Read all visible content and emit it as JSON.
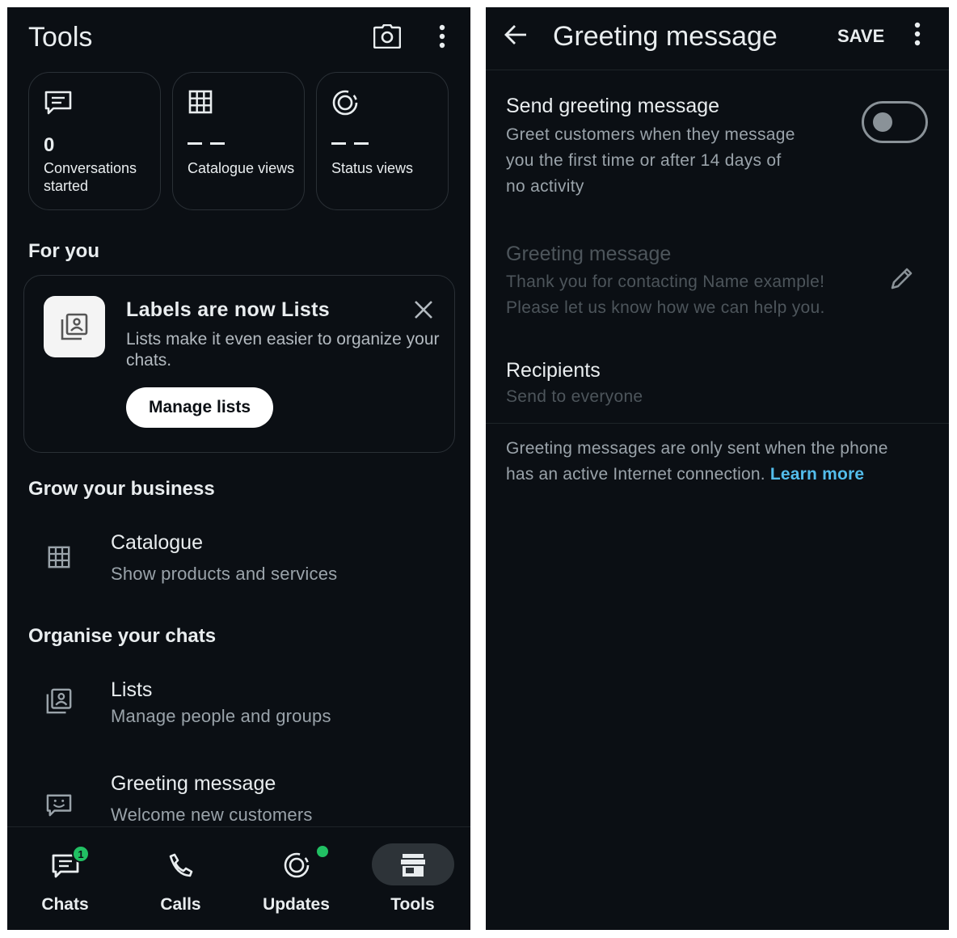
{
  "left": {
    "title": "Tools",
    "stats": [
      {
        "value": "0",
        "label": "Conversations started"
      },
      {
        "value": "– –",
        "label": "Catalogue views"
      },
      {
        "value": "– –",
        "label": "Status views"
      }
    ],
    "for_you": "For you",
    "promo": {
      "title": "Labels are now Lists",
      "body": "Lists make it even easier to organize your chats.",
      "button": "Manage lists"
    },
    "grow_section": "Grow your business",
    "catalogue": {
      "title": "Catalogue",
      "subtitle": "Show products and services"
    },
    "organise_section": "Organise your chats",
    "lists": {
      "title": "Lists",
      "subtitle": "Manage people and groups"
    },
    "greeting": {
      "title": "Greeting message",
      "subtitle": "Welcome new customers"
    },
    "nav": [
      {
        "label": "Chats",
        "badge": "1"
      },
      {
        "label": "Calls"
      },
      {
        "label": "Updates"
      },
      {
        "label": "Tools"
      }
    ]
  },
  "right": {
    "title": "Greeting message",
    "save": "SAVE",
    "send_label": "Send greeting message",
    "send_desc_1": "Greet customers when they message",
    "send_desc_2": "you the first time or after 14 days of",
    "send_desc_3": "no activity",
    "toggle_on": false,
    "msg_label": "Greeting message",
    "msg_line_1": "Thank you for contacting Name example!",
    "msg_line_2": "Please let us know how we can help you.",
    "recipients_label": "Recipients",
    "recipients_value": "Send to everyone",
    "note_1": "Greeting messages are only sent when the phone",
    "note_2": "has an active Internet connection.",
    "learn_more": "Learn more"
  },
  "colors": {
    "accent_green": "#21c063",
    "link_blue": "#53bdeb",
    "background": "#0b0f14"
  }
}
